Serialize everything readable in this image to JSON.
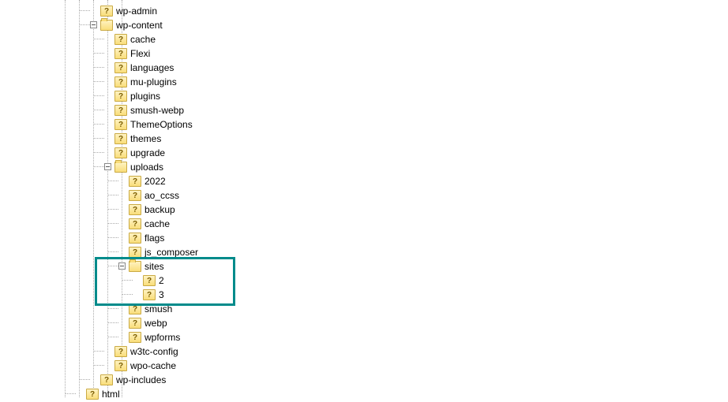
{
  "tree": {
    "root_items": [
      {
        "label": "wp-admin",
        "icon": "question",
        "depth": 3,
        "toggle": "none"
      },
      {
        "label": "wp-content",
        "icon": "folder",
        "depth": 3,
        "toggle": "minus",
        "children": [
          {
            "label": "cache",
            "icon": "question",
            "depth": 4,
            "toggle": "none"
          },
          {
            "label": "Flexi",
            "icon": "question",
            "depth": 4,
            "toggle": "none"
          },
          {
            "label": "languages",
            "icon": "question",
            "depth": 4,
            "toggle": "none"
          },
          {
            "label": "mu-plugins",
            "icon": "question",
            "depth": 4,
            "toggle": "none"
          },
          {
            "label": "plugins",
            "icon": "question",
            "depth": 4,
            "toggle": "none"
          },
          {
            "label": "smush-webp",
            "icon": "question",
            "depth": 4,
            "toggle": "none"
          },
          {
            "label": "ThemeOptions",
            "icon": "question",
            "depth": 4,
            "toggle": "none"
          },
          {
            "label": "themes",
            "icon": "question",
            "depth": 4,
            "toggle": "none"
          },
          {
            "label": "upgrade",
            "icon": "question",
            "depth": 4,
            "toggle": "none"
          },
          {
            "label": "uploads",
            "icon": "folder",
            "depth": 4,
            "toggle": "minus",
            "children": [
              {
                "label": "2022",
                "icon": "question",
                "depth": 5,
                "toggle": "none"
              },
              {
                "label": "ao_ccss",
                "icon": "question",
                "depth": 5,
                "toggle": "none"
              },
              {
                "label": "backup",
                "icon": "question",
                "depth": 5,
                "toggle": "none"
              },
              {
                "label": "cache",
                "icon": "question",
                "depth": 5,
                "toggle": "none"
              },
              {
                "label": "flags",
                "icon": "question",
                "depth": 5,
                "toggle": "none"
              },
              {
                "label": "js_composer",
                "icon": "question",
                "depth": 5,
                "toggle": "none"
              },
              {
                "label": "sites",
                "icon": "folder",
                "depth": 5,
                "toggle": "minus",
                "highlighted": true,
                "children": [
                  {
                    "label": "2",
                    "icon": "question",
                    "depth": 6,
                    "toggle": "none",
                    "highlighted": true
                  },
                  {
                    "label": "3",
                    "icon": "question",
                    "depth": 6,
                    "toggle": "none",
                    "highlighted": true
                  }
                ]
              },
              {
                "label": "smush",
                "icon": "question",
                "depth": 5,
                "toggle": "none"
              },
              {
                "label": "webp",
                "icon": "question",
                "depth": 5,
                "toggle": "none"
              },
              {
                "label": "wpforms",
                "icon": "question",
                "depth": 5,
                "toggle": "none"
              }
            ]
          },
          {
            "label": "w3tc-config",
            "icon": "question",
            "depth": 4,
            "toggle": "none"
          },
          {
            "label": "wpo-cache",
            "icon": "question",
            "depth": 4,
            "toggle": "none"
          }
        ]
      },
      {
        "label": "wp-includes",
        "icon": "question",
        "depth": 3,
        "toggle": "none"
      },
      {
        "label": "html",
        "icon": "question",
        "depth": 2,
        "toggle": "none"
      }
    ]
  },
  "highlight": {
    "color": "#008b8b"
  }
}
